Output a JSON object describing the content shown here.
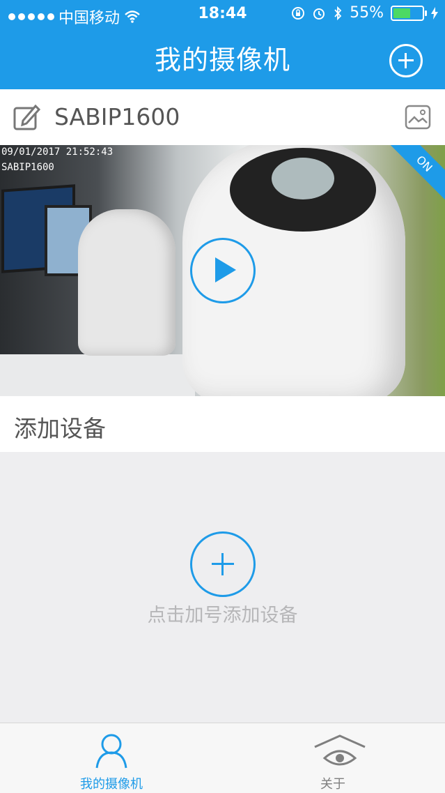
{
  "status_bar": {
    "carrier": "中国移动",
    "time": "18:44",
    "battery": "55%",
    "battery_level": 0.55
  },
  "nav": {
    "title": "我的摄像机"
  },
  "device": {
    "name": "SABIP1600",
    "overlay_date": "09/01/2017 21:52:43",
    "overlay_name": "SABIP1600",
    "status_badge": "ON"
  },
  "add_section": {
    "title": "添加设备",
    "hint": "点击加号添加设备"
  },
  "tabs": [
    {
      "label": "我的摄像机",
      "icon": "person-icon",
      "active": true
    },
    {
      "label": "关于",
      "icon": "eye-house-icon",
      "active": false
    }
  ],
  "colors": {
    "accent": "#1e9be8",
    "battery_fill": "#4cd964"
  }
}
